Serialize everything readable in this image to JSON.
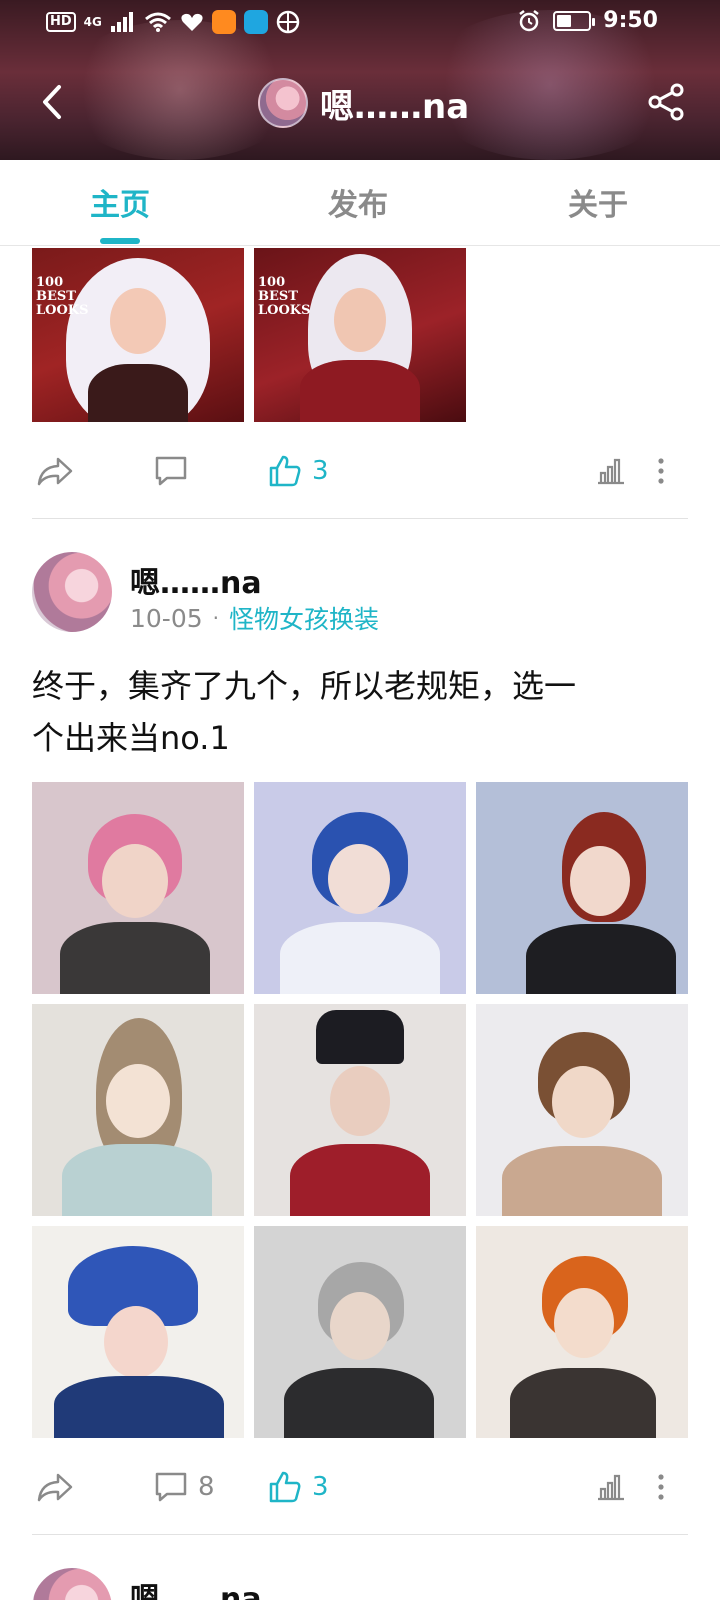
{
  "status_bar": {
    "hd": "HD",
    "network": "4G",
    "time": "9:50"
  },
  "nav": {
    "title": "嗯……na"
  },
  "tabs": [
    {
      "label": "主页",
      "active": true
    },
    {
      "label": "发布",
      "active": false
    },
    {
      "label": "关于",
      "active": false
    }
  ],
  "post1": {
    "image_captions": [
      "100 BEST LOOKS",
      "100 BEST LOOKS"
    ],
    "likes": "3"
  },
  "post2": {
    "author": "嗯……na",
    "date": "10-05",
    "separator": "·",
    "topic": "怪物女孩换装",
    "text_line1": "终于，集齐了九个，所以老规矩，选一",
    "text_line2": "个出来当no.1",
    "comments": "8",
    "likes": "3"
  },
  "post3": {
    "author": "嗯……na"
  },
  "colors": {
    "accent": "#1fb5c7",
    "header_bg": "#5a2632"
  }
}
